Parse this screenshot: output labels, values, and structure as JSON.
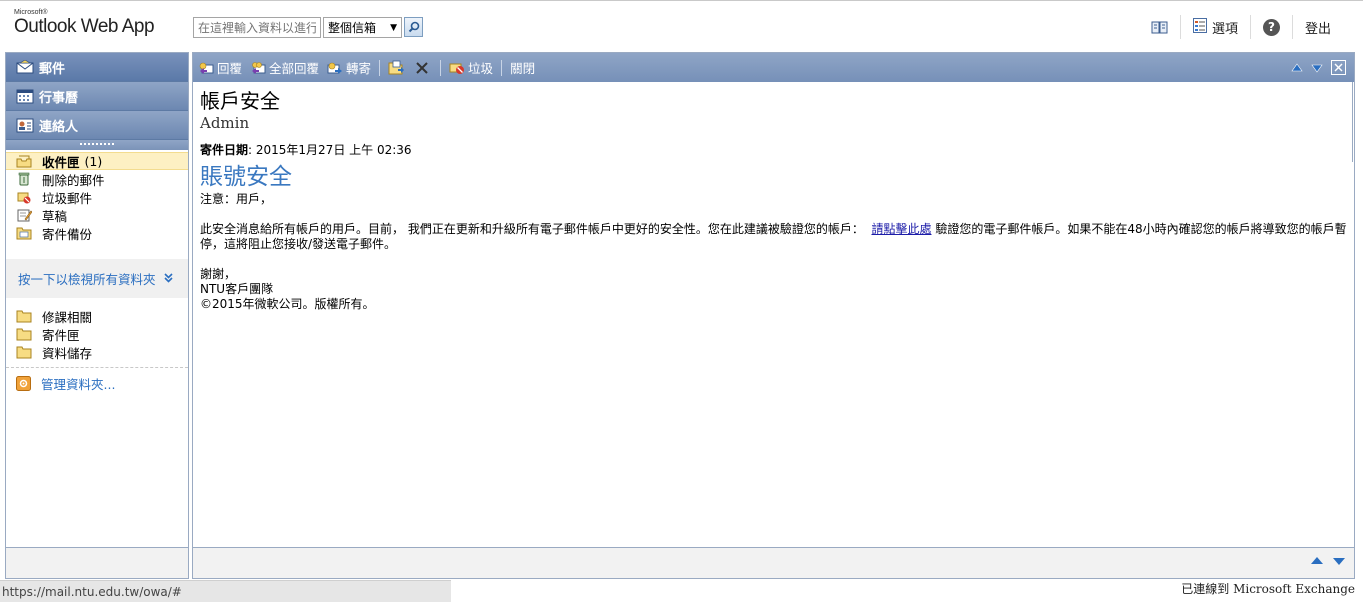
{
  "header": {
    "logo_small": "Microsoft®",
    "logo_name": "Outlook Web App",
    "search_placeholder": "在這裡輸入資料以進行",
    "scope_value": "整個信箱",
    "options_label": "選項",
    "signout_label": "登出"
  },
  "nav": {
    "buttons": [
      {
        "label": "郵件",
        "icon": "mail-icon"
      },
      {
        "label": "行事曆",
        "icon": "calendar-icon"
      },
      {
        "label": "連絡人",
        "icon": "contacts-icon"
      }
    ],
    "folders": [
      {
        "label": "收件匣",
        "count": "(1)",
        "icon": "inbox-icon"
      },
      {
        "label": "刪除的郵件",
        "icon": "deleted-items-icon"
      },
      {
        "label": "垃圾郵件",
        "icon": "junk-mail-icon"
      },
      {
        "label": "草稿",
        "icon": "drafts-icon"
      },
      {
        "label": "寄件備份",
        "icon": "sent-items-icon"
      }
    ],
    "show_all": "按一下以檢視所有資料夾",
    "favorites": [
      {
        "label": "修課相關"
      },
      {
        "label": "寄件匣"
      },
      {
        "label": "資料儲存"
      }
    ],
    "manage": "管理資料夾..."
  },
  "toolbar": {
    "reply": "回覆",
    "reply_all": "全部回覆",
    "forward": "轉寄",
    "junk": "垃圾",
    "close": "關閉"
  },
  "message": {
    "subject": "帳戶安全",
    "sender": "Admin",
    "sent_label": "寄件日期",
    "sent_value": ": 2015年1月27日 上午 02:36",
    "body_title": "賬號安全",
    "greeting": "注意：用戶，",
    "para_before_link": "此安全消息給所有帳戶的用戶。目前， 我們正在更新和升級所有電子郵件帳戶中更好的安全性。您在此建議被驗證您的帳戶：",
    "link_text": "請點擊此處",
    "para_after_link": "驗證您的電子郵件帳戶。如果不能在48小時內確認您的帳戶將導致您的帳戶暫停，這將阻止您接收/發送電子郵件。",
    "thanks": "謝謝，",
    "signature_org": "NTU客戶團隊",
    "copyright": "©2015年微軟公司。版權所有。"
  },
  "status": {
    "url": "https://mail.ntu.edu.tw/owa/#",
    "connection": "已連線到 Microsoft Exchange"
  },
  "colors": {
    "nav_blue": "#7690b8",
    "link_blue": "#2a6ec0",
    "selected_folder": "#fdf0c3",
    "body_title": "#3a78c0"
  }
}
